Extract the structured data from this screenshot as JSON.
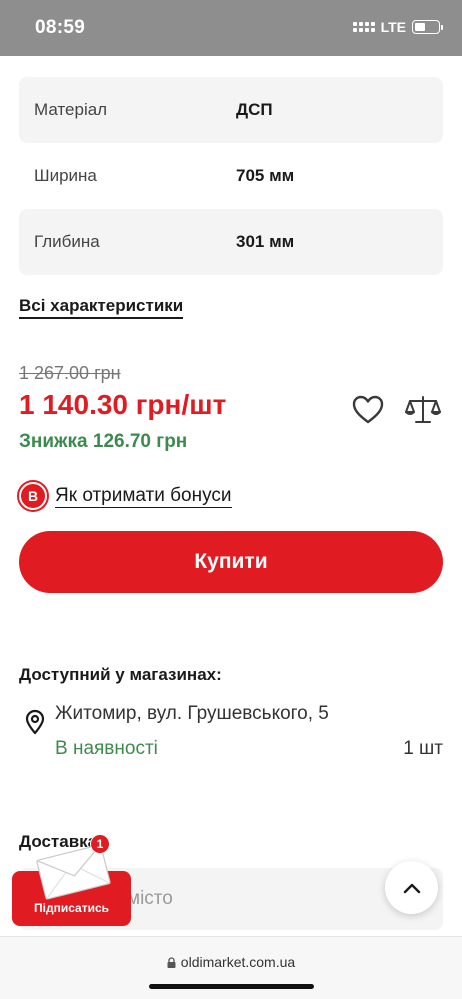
{
  "status_bar": {
    "time": "08:59",
    "network": "LTE"
  },
  "specs": [
    {
      "label": "Матеріал",
      "value": "ДСП"
    },
    {
      "label": "Ширина",
      "value": "705 мм"
    },
    {
      "label": "Глибина",
      "value": "301 мм"
    }
  ],
  "all_specs_link": "Всі характеристики",
  "price": {
    "old": "1 267.00 грн",
    "current": "1 140.30 грн/шт",
    "discount": "Знижка 126.70 грн"
  },
  "icons": {
    "wishlist": "heart-icon",
    "compare": "scale-icon",
    "location": "map-pin-icon",
    "scroll_top": "chevron-up-icon",
    "subscribe": "envelope-icon"
  },
  "bonus": {
    "badge": "B",
    "link": "Як отримати бонуси"
  },
  "buy_button": "Купити",
  "availability": {
    "title": "Доступний у магазинах:",
    "store": "Житомир, вул. Грушевського, 5",
    "status": "В наявності",
    "quantity": "1 шт"
  },
  "delivery": {
    "title": "Доставка",
    "city_placeholder": "місто"
  },
  "subscribe": {
    "label": "Підписатись",
    "badge_count": "1"
  },
  "browser": {
    "url": "oldimarket.com.ua"
  },
  "colors": {
    "brand_red": "#e11b22",
    "success_green": "#3d8a4e",
    "row_gray": "#f4f4f4"
  }
}
